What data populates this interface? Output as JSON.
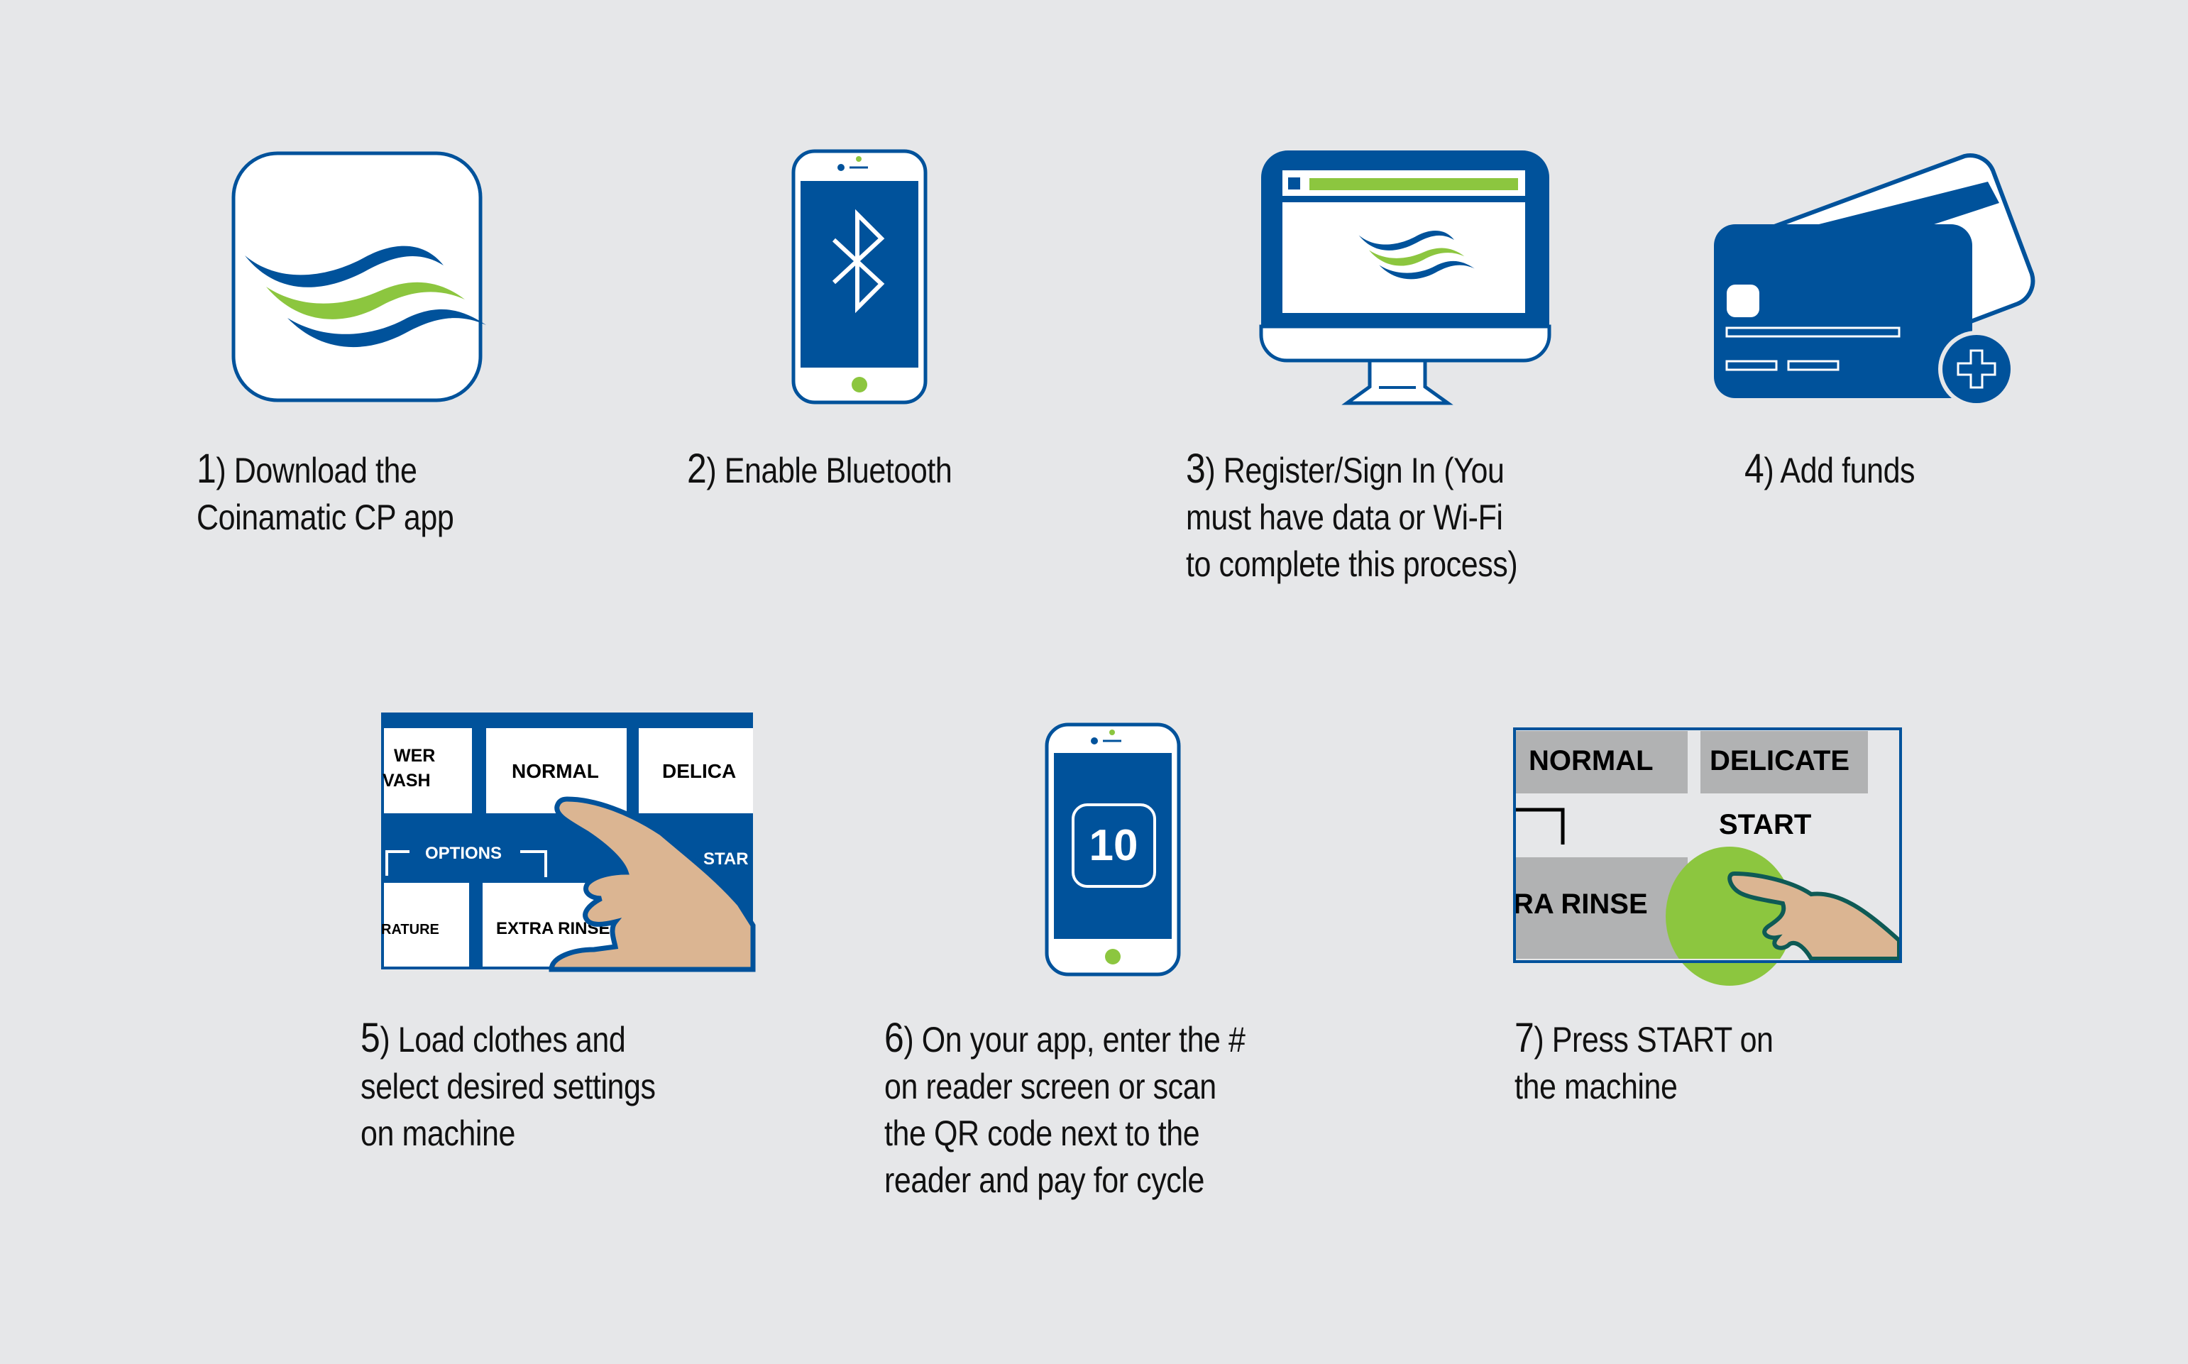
{
  "colors": {
    "background": "#e6e7e9",
    "brand_blue": "#00529b",
    "brand_green": "#8cc63f",
    "white": "#ffffff",
    "panel_gray": "#b1b2b3",
    "skin": "#dbb592",
    "text": "#111111"
  },
  "steps": [
    {
      "number": "1",
      "text": ") Download the\nCoinamatic CP app",
      "icon": "app-icon-waves"
    },
    {
      "number": "2",
      "text": ") Enable Bluetooth",
      "icon": "phone-bluetooth-icon"
    },
    {
      "number": "3",
      "text": ") Register/Sign In  (You\nmust have data or Wi-Fi\nto complete this process)",
      "icon": "desktop-monitor-icon"
    },
    {
      "number": "4",
      "text": ") Add funds",
      "icon": "credit-cards-add-icon"
    },
    {
      "number": "5",
      "text": ") Load clothes and\nselect desired settings\non machine",
      "icon": "machine-settings-panel-icon"
    },
    {
      "number": "6",
      "text": ") On your app, enter the #\non reader screen or scan\nthe QR code next to the\nreader and pay for cycle",
      "icon": "phone-reader-number-icon"
    },
    {
      "number": "7",
      "text": ") Press START on\nthe machine",
      "icon": "start-button-press-icon"
    }
  ],
  "panel5": {
    "buttons": [
      "WER\nVASH",
      "NORMAL",
      "DELICA",
      "RATURE",
      "EXTRA RINSE"
    ],
    "options_label": "OPTIONS",
    "start_label": "STAR"
  },
  "phone6": {
    "reader_number": "10"
  },
  "panel7": {
    "buttons": [
      "NORMAL",
      "DELICATE",
      "RA RINSE"
    ],
    "start_label": "START"
  }
}
